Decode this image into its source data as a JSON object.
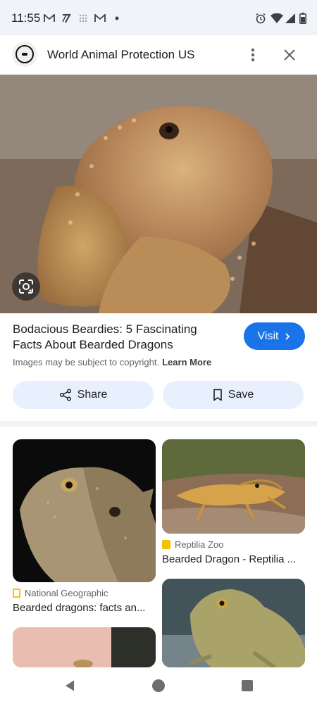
{
  "status_bar": {
    "time": "11:55",
    "icons": [
      "gmail-icon",
      "news-icon",
      "grid-icon",
      "gmail-icon",
      "dot-icon",
      "alarm-icon",
      "wifi-icon",
      "signal-icon",
      "battery-icon"
    ]
  },
  "header": {
    "title": "World Animal Protection US",
    "logo": "world-animal-protection-logo"
  },
  "result": {
    "title": "Bodacious Beardies: 5 Fascinating Facts About Bearded Dragons",
    "visit_label": "Visit",
    "copyright": "Images may be subject to copyright.",
    "learn_more": "Learn More",
    "share_label": "Share",
    "save_label": "Save"
  },
  "related": [
    {
      "source": "National Geographic",
      "caption": "Bearded dragons: facts an...",
      "source_color": "#f9c400"
    },
    {
      "source": "Reptilia Zoo",
      "caption": "Bearded Dragon - Reptilia ...",
      "source_color": "#f2c200"
    }
  ],
  "colors": {
    "accent": "#1a73e8",
    "button_tint": "#e8f0fe"
  }
}
